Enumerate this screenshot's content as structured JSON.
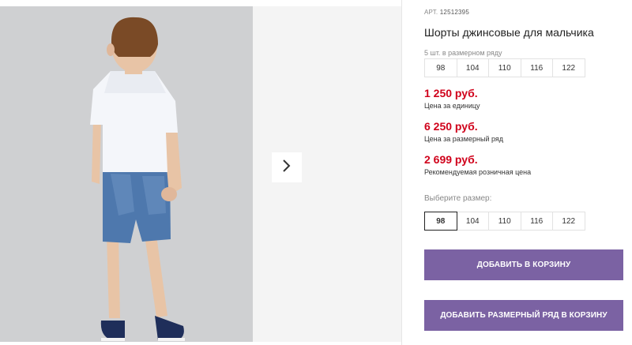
{
  "product": {
    "sku_prefix": "АРТ.",
    "sku": "12512395",
    "title": "Шорты джинсовые для мальчика"
  },
  "size_row": {
    "label": "5 шт. в размерном ряду",
    "sizes": [
      "98",
      "104",
      "110",
      "116",
      "122"
    ]
  },
  "prices": [
    {
      "value": "1 250 руб.",
      "caption": "Цена за единицу"
    },
    {
      "value": "6 250 руб.",
      "caption": "Цена за размерный ряд"
    },
    {
      "value": "2 699 руб.",
      "caption": "Рекомендуемая розничная цена"
    }
  ],
  "size_select": {
    "label": "Выберите размер:",
    "options": [
      "98",
      "104",
      "110",
      "116",
      "122"
    ],
    "selected": "98"
  },
  "buttons": {
    "add_to_cart": "ДОБАВИТЬ В КОРЗИНУ",
    "add_row_to_cart": "ДОБАВИТЬ РАЗМЕРНЫЙ РЯД В КОРЗИНУ"
  },
  "colors": {
    "accent": "#7b62a3",
    "price": "#d0021b"
  },
  "icons": {
    "next": "chevron-right-icon"
  }
}
